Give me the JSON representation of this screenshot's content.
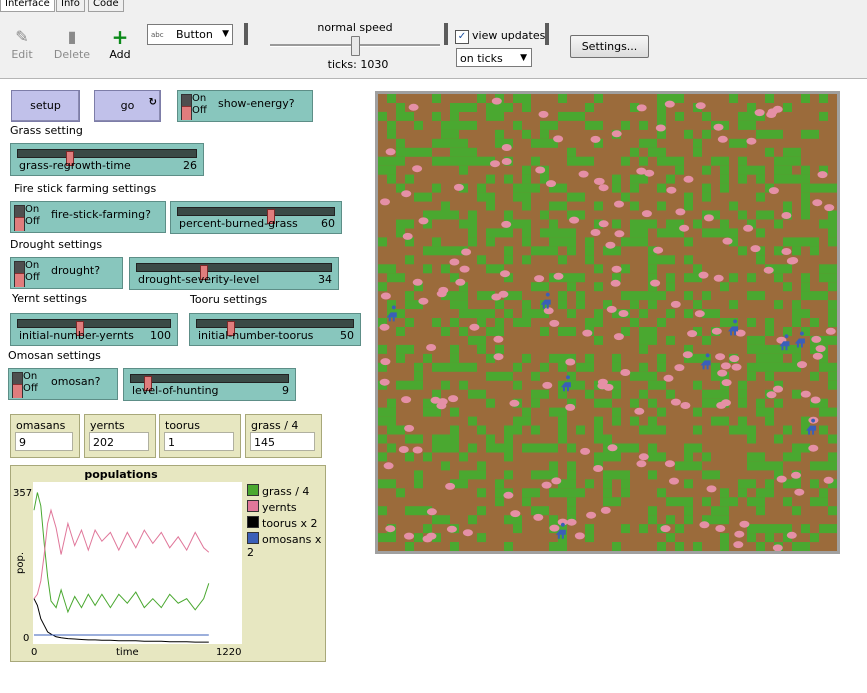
{
  "tabs": [
    {
      "label": "Interface",
      "active": true
    },
    {
      "label": "Info",
      "active": false
    },
    {
      "label": "Code",
      "active": false
    }
  ],
  "toolbar": {
    "edit_label": "Edit",
    "delete_label": "Delete",
    "add_label": "Add",
    "widget_type": "Button",
    "widget_icon_text": "abc",
    "speed_label": "normal speed",
    "speed_fraction": 0.5,
    "ticks_label": "ticks: 1030",
    "view_updates_label": "view updates",
    "view_updates_checked": true,
    "update_mode": "on ticks",
    "settings_label": "Settings..."
  },
  "buttons": {
    "setup": "setup",
    "go": "go"
  },
  "switches": {
    "on_label": "On",
    "off_label": "Off",
    "show_energy": {
      "label": "show-energy?",
      "on": false
    },
    "fire_stick_farming": {
      "label": "fire-stick-farming?",
      "on": false
    },
    "drought": {
      "label": "drought?",
      "on": false
    },
    "omosan": {
      "label": "omosan?",
      "on": false
    }
  },
  "notes": {
    "grass_setting": "Grass setting",
    "fire_stick_settings": "Fire stick farming settings",
    "drought_settings": "Drought settings",
    "yernt_settings": "Yernt settings",
    "tooru_settings": "Tooru settings",
    "omosan_settings": "Omosan settings"
  },
  "sliders": {
    "grass_regrowth_time": {
      "label": "grass-regrowth-time",
      "value": "26",
      "fraction": 0.28
    },
    "percent_burned_grass": {
      "label": "percent-burned-grass",
      "value": "60",
      "fraction": 0.6
    },
    "drought_severity_level": {
      "label": "drought-severity-level",
      "value": "34",
      "fraction": 0.34
    },
    "initial_number_yernts": {
      "label": "initial-number-yernts",
      "value": "100",
      "fraction": 0.4
    },
    "initial_number_toorus": {
      "label": "initial-number-toorus",
      "value": "50",
      "fraction": 0.2
    },
    "level_of_hunting": {
      "label": "level-of-hunting",
      "value": "9",
      "fraction": 0.09
    }
  },
  "monitors": {
    "omasans": {
      "label": "omasans",
      "value": "9"
    },
    "yernts": {
      "label": "yernts",
      "value": "202"
    },
    "toorus": {
      "label": "toorus",
      "value": "1"
    },
    "grass": {
      "label": "grass / 4",
      "value": "145"
    }
  },
  "chart_data": {
    "type": "line",
    "title": "populations",
    "xlabel": "time",
    "ylabel": "pop.",
    "xlim": [
      0,
      1220
    ],
    "ylim": [
      0,
      357
    ],
    "x_tick_labels": [
      "0",
      "1220"
    ],
    "y_tick_labels": [
      "0",
      "357"
    ],
    "legend_position": "right",
    "series": [
      {
        "name": "grass / 4",
        "color": "#4aa830",
        "x": [
          0,
          20,
          40,
          60,
          80,
          100,
          130,
          160,
          200,
          240,
          280,
          320,
          360,
          400,
          450,
          500,
          550,
          600,
          650,
          700,
          750,
          800,
          850,
          900,
          950,
          1000,
          1030
        ],
        "values": [
          300,
          340,
          310,
          225,
          150,
          95,
          80,
          120,
          70,
          105,
          80,
          110,
          85,
          110,
          80,
          110,
          90,
          115,
          80,
          100,
          80,
          110,
          90,
          100,
          75,
          100,
          135
        ]
      },
      {
        "name": "yernts",
        "color": "#e0779a",
        "x": [
          0,
          20,
          40,
          60,
          80,
          100,
          130,
          160,
          200,
          240,
          280,
          320,
          360,
          400,
          450,
          500,
          550,
          600,
          650,
          700,
          750,
          800,
          850,
          900,
          950,
          1000,
          1030
        ],
        "values": [
          100,
          110,
          140,
          200,
          270,
          300,
          260,
          200,
          270,
          220,
          255,
          210,
          255,
          230,
          250,
          210,
          250,
          215,
          255,
          225,
          250,
          215,
          240,
          210,
          250,
          215,
          205
        ]
      },
      {
        "name": "toorus x 2",
        "color": "#000000",
        "x": [
          0,
          20,
          40,
          60,
          80,
          100,
          130,
          160,
          200,
          240,
          280,
          320,
          360,
          400,
          450,
          500,
          550,
          600,
          650,
          700,
          750,
          800,
          850,
          900,
          950,
          1000,
          1030
        ],
        "values": [
          100,
          85,
          55,
          40,
          25,
          20,
          14,
          12,
          10,
          9,
          8,
          7,
          7,
          6,
          6,
          5,
          5,
          5,
          4,
          4,
          4,
          3,
          3,
          3,
          2,
          2,
          2
        ]
      },
      {
        "name": "omosans x 2",
        "color": "#3a5fb8",
        "x": [
          0,
          20,
          40,
          60,
          80,
          100,
          130,
          160,
          200,
          240,
          280,
          320,
          360,
          400,
          450,
          500,
          550,
          600,
          650,
          700,
          750,
          800,
          850,
          900,
          950,
          1000,
          1030
        ],
        "values": [
          18,
          18,
          18,
          18,
          18,
          18,
          18,
          18,
          18,
          18,
          18,
          18,
          18,
          18,
          18,
          18,
          18,
          18,
          18,
          18,
          18,
          18,
          18,
          18,
          18,
          18,
          18
        ]
      }
    ]
  },
  "world": {
    "grass_color": "#4aa830",
    "dirt_color": "#9b6b3b",
    "yernt_color": "#e590a6",
    "omosan_color": "#3a5fb8"
  }
}
